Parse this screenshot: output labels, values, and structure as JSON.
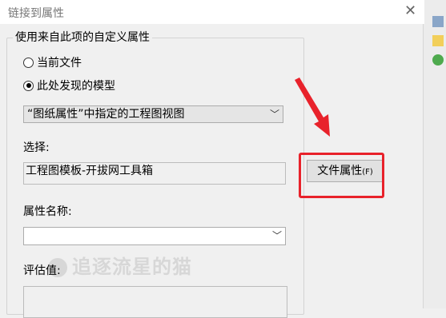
{
  "window": {
    "title": "链接到属性",
    "close_glyph": "✕"
  },
  "group": {
    "label": "使用来自此项的自定义属性"
  },
  "options": [
    {
      "label": "当前文件",
      "checked": false
    },
    {
      "label": "此处发现的模型",
      "checked": true
    }
  ],
  "model_combo": {
    "value": "“图纸属性”中指定的工程图视图"
  },
  "select": {
    "label": "选择:",
    "value": "工程图模板-开拔网工具箱"
  },
  "file_properties_button": {
    "label": "文件属性",
    "mnemonic": "(F)"
  },
  "property_name": {
    "label": "属性名称:",
    "value": ""
  },
  "evaluated_value": {
    "label": "评估值:",
    "value": ""
  },
  "watermark": {
    "text": "追逐流星的猫"
  },
  "colors": {
    "highlight": "#e8222b",
    "arrow": "#e8222b"
  },
  "icons": [
    "close-icon",
    "chevron-down-icon",
    "red-arrow-icon",
    "right-toolbar-icons"
  ]
}
